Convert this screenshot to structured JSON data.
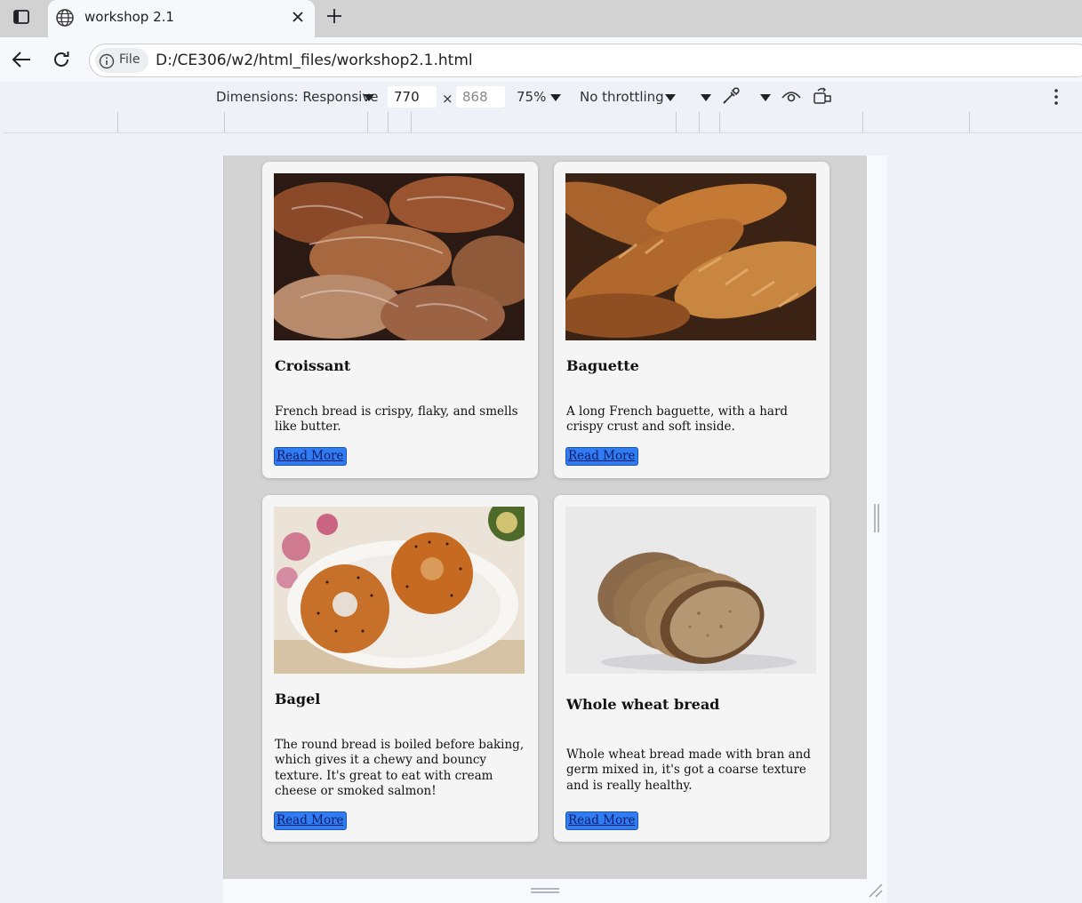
{
  "browser": {
    "tab_title": "workshop 2.1",
    "chip_label": "File",
    "url": "D:/CE306/w2/html_files/workshop2.1.html"
  },
  "devtools": {
    "dimensions_label": "Dimensions: Responsive",
    "width": "770",
    "height": "868",
    "times": "×",
    "zoom": "75%",
    "throttling": "No throttling"
  },
  "cards": [
    {
      "title": "Croissant",
      "text": "French bread is crispy, flaky, and smells like butter.",
      "button": "Read More",
      "image": "croissants"
    },
    {
      "title": "Baguette",
      "text": "A long French baguette, with a hard crispy crust and soft inside.",
      "button": "Read More",
      "image": "baguettes"
    },
    {
      "title": "Bagel",
      "text": "The round bread is boiled before baking, which gives it a chewy and bouncy texture. It's great to eat with cream cheese or smoked salmon!",
      "button": "Read More",
      "image": "bagels on plate"
    },
    {
      "title": "Whole wheat bread",
      "text": "Whole wheat bread made with bran and germ mixed in, it's got a coarse texture and is really healthy.",
      "button": "Read More",
      "image": "sliced whole wheat bread"
    }
  ]
}
